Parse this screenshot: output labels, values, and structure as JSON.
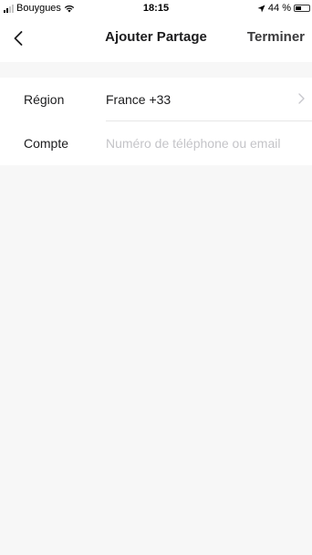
{
  "status_bar": {
    "carrier": "Bouygues",
    "time": "18:15",
    "battery_text": "44 %",
    "battery_level": 0.44
  },
  "nav": {
    "title": "Ajouter Partage",
    "done_label": "Terminer"
  },
  "form": {
    "region": {
      "label": "Région",
      "value": "France +33"
    },
    "account": {
      "label": "Compte",
      "value": "",
      "placeholder": "Numéro de téléphone ou email"
    }
  }
}
